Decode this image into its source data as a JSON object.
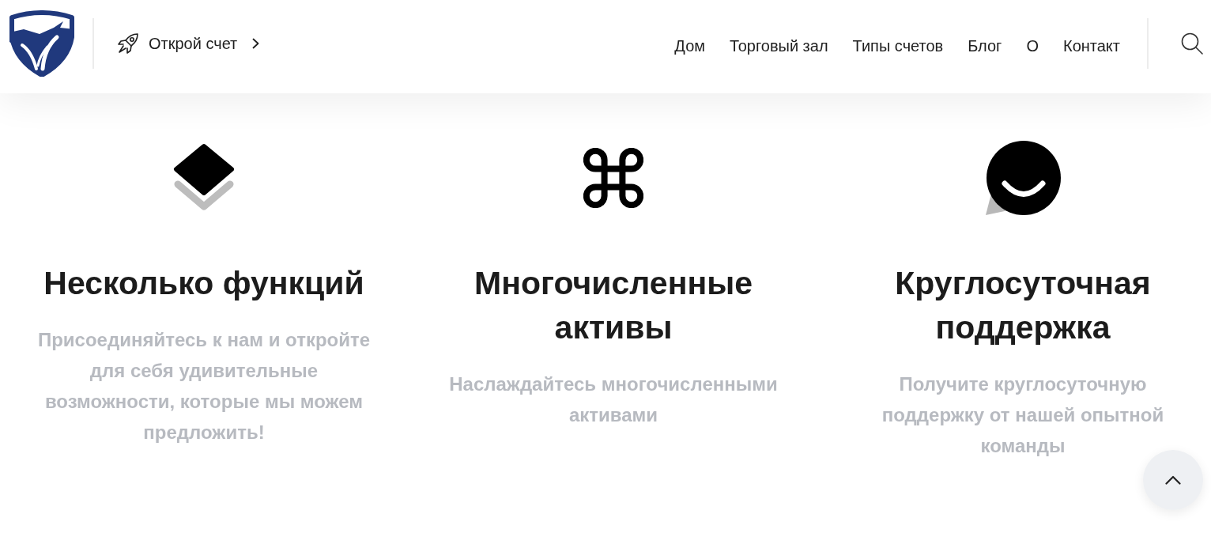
{
  "header": {
    "open_account_link": "Открой счет",
    "nav": [
      {
        "label": "Дом"
      },
      {
        "label": "Торговый зал"
      },
      {
        "label": "Типы счетов"
      },
      {
        "label": "Блог"
      },
      {
        "label": "О"
      },
      {
        "label": "Контакт"
      }
    ]
  },
  "features": [
    {
      "kind": "layers",
      "title": "Несколько функций",
      "description": "Присоединяйтесь к нам и откройте для себя удивительные возможности, которые мы можем предложить!"
    },
    {
      "kind": "command",
      "title": "Многочисленные активы",
      "description": "Наслаждайтесь многочисленными активами"
    },
    {
      "kind": "chat",
      "title": "Круглосуточная поддержка",
      "description": "Получите круглосуточную поддержку от нашей опытной команды"
    }
  ]
}
